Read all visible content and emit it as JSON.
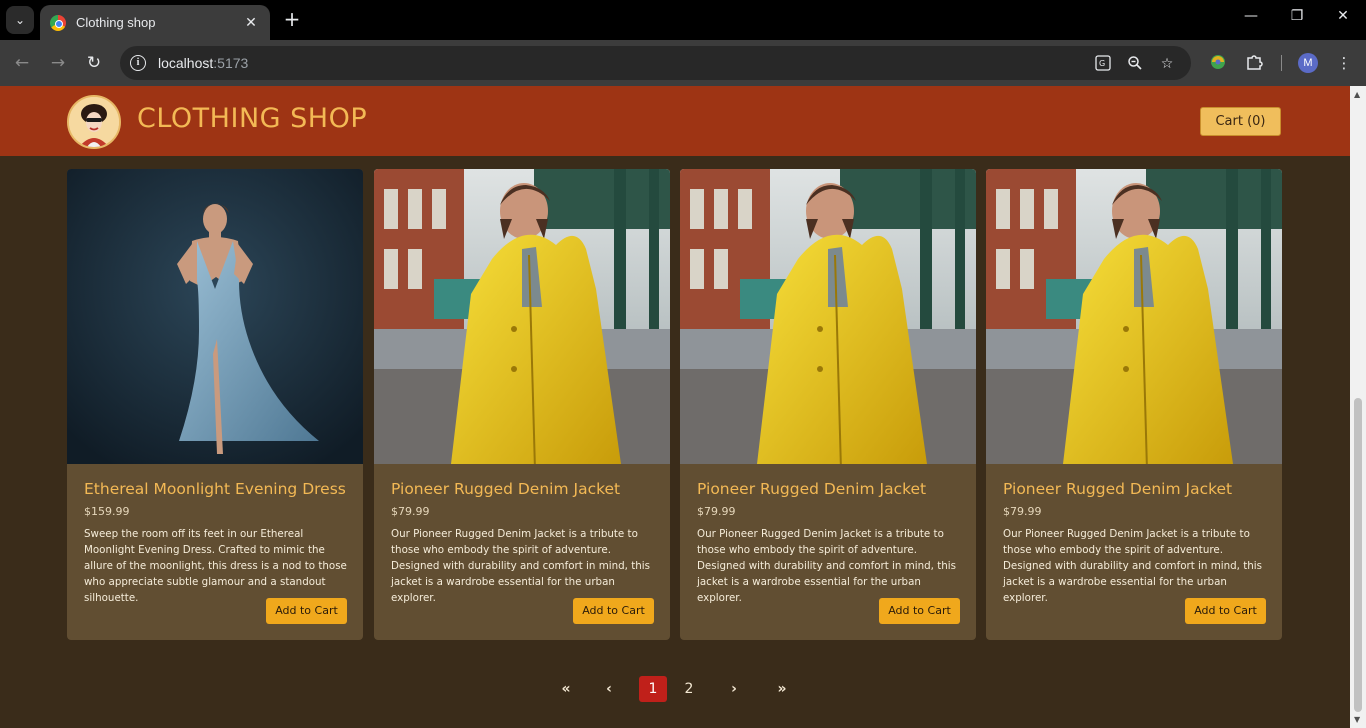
{
  "browser": {
    "tab_title": "Clothing shop",
    "tab_close": "✕",
    "new_tab": "+",
    "url_host": "localhost",
    "url_port": ":5173",
    "profile_initial": "M",
    "window_controls": {
      "minimize": "—",
      "restore": "❐",
      "close": "✕"
    },
    "nav": {
      "back": "←",
      "forward": "→",
      "reload": "↻"
    },
    "icons": [
      "translate-icon",
      "zoom-out-icon",
      "star-icon",
      "extension-colorful-icon",
      "puzzle-extension-icon",
      "kebab-menu-icon"
    ]
  },
  "header": {
    "title": "CLOTHING SHOP",
    "cart_label": "Cart (0)"
  },
  "products": [
    {
      "name": "Ethereal Moonlight Evening Dress",
      "price": "$159.99",
      "description": "Sweep the room off its feet in our Ethereal Moonlight Evening Dress. Crafted to mimic the allure of the moonlight, this dress is a nod to those who appreciate subtle glamour and a standout silhouette.",
      "button": "Add to Cart",
      "image": "woman-blue-gown-photo"
    },
    {
      "name": "Pioneer Rugged Denim Jacket",
      "price": "$79.99",
      "description": "Our Pioneer Rugged Denim Jacket is a tribute to those who embody the spirit of adventure. Designed with durability and comfort in mind, this jacket is a wardrobe essential for the urban explorer.",
      "button": "Add to Cart",
      "image": "man-yellow-raincoat-photo"
    },
    {
      "name": "Pioneer Rugged Denim Jacket",
      "price": "$79.99",
      "description": "Our Pioneer Rugged Denim Jacket is a tribute to those who embody the spirit of adventure. Designed with durability and comfort in mind, this jacket is a wardrobe essential for the urban explorer.",
      "button": "Add to Cart",
      "image": "man-yellow-raincoat-photo"
    },
    {
      "name": "Pioneer Rugged Denim Jacket",
      "price": "$79.99",
      "description": "Our Pioneer Rugged Denim Jacket is a tribute to those who embody the spirit of adventure. Designed with durability and comfort in mind, this jacket is a wardrobe essential for the urban explorer.",
      "button": "Add to Cart",
      "image": "man-yellow-raincoat-photo"
    }
  ],
  "pagination": {
    "first": "«",
    "prev": "‹",
    "pages": [
      "1",
      "2"
    ],
    "current": "1",
    "next": "›",
    "last": "»"
  },
  "colors": {
    "header_bg": "#9e3414",
    "page_bg": "#3a2c1a",
    "card_bg": "#614e32",
    "accent_text": "#f3b955",
    "button_bg": "#f0a81c",
    "active_page": "#c0201a"
  }
}
